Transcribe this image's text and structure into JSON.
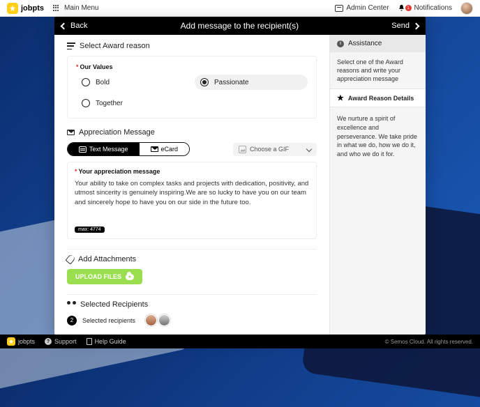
{
  "topbar": {
    "brand": "jobpts",
    "mainmenu": "Main Menu",
    "admin_center": "Admin Center",
    "notifications": "Notifications",
    "notif_count": "1"
  },
  "header": {
    "back": "Back",
    "title": "Add message to the recipient(s)",
    "send": "Send"
  },
  "award": {
    "section": "Select Award reason",
    "group_label": "Our Values",
    "options": [
      {
        "label": "Bold",
        "selected": false
      },
      {
        "label": "Passionate",
        "selected": true
      },
      {
        "label": "Together",
        "selected": false
      }
    ]
  },
  "message": {
    "section": "Appreciation Message",
    "toggle_text": "Text Message",
    "toggle_ecard": "eCard",
    "gif_placeholder": "Choose a GIF",
    "field_label": "Your appreciation message",
    "body": "Your ability to take on complex tasks and projects with dedication, positivity, and utmost sincerity is genuinely inspiring.We are so lucky to have you on our team and sincerely hope to have you on our side in the future too.",
    "char_badge": "max: 4774"
  },
  "attachments": {
    "section": "Add Attachments",
    "upload": "UPLOAD FILES"
  },
  "recipients": {
    "section": "Selected Recipients",
    "count": "2",
    "label": "Selected recipients"
  },
  "sidebar": {
    "assistance": "Assistance",
    "hint": "Select one of the Award reasons and write your appreciation message",
    "details_title": "Award Reason Details",
    "details_body": "We nurture a spirit of excellence and perseverance. We take pride in what we do, how we do it, and who we do it for."
  },
  "footer": {
    "brand": "jobpts",
    "support": "Support",
    "help": "Help Guide",
    "copyright": "© Semos Cloud. All rights reserved."
  }
}
